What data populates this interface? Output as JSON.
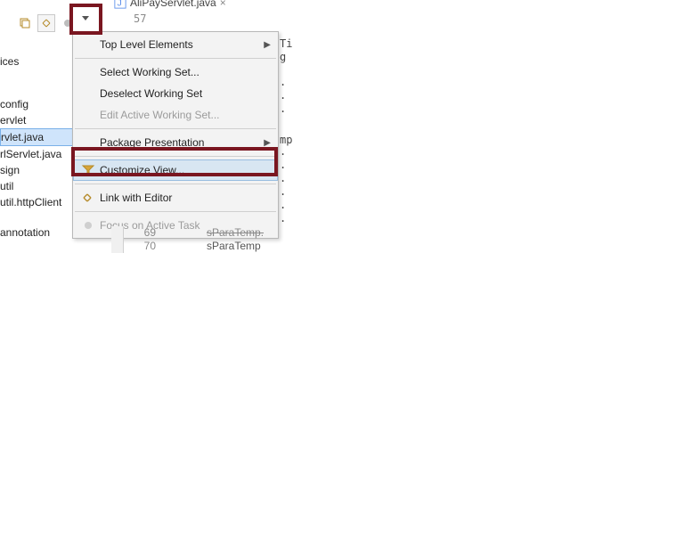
{
  "editorTab": {
    "filename": "AliPayServlet.java"
  },
  "lineVisible": "57",
  "sidebar": {
    "groupTop": "ices",
    "items": [
      "config",
      "ervlet",
      "rvlet.java",
      "rlServlet.java",
      "sign",
      "util",
      "util.httpClient"
    ],
    "groupBottom": "annotation"
  },
  "menu": {
    "topLevelElements": "Top Level Elements",
    "selectWS": "Select Working Set...",
    "deselectWS": "Deselect Working Set",
    "editWS": "Edit Active Working Set...",
    "packagePresentation": "Package Presentation",
    "customizeView": "Customize View...",
    "linkEditor": "Link with Editor",
    "focusTask": "Focus on Active Task"
  },
  "peek": {
    "l1": "Ti",
    "l2": "g",
    "l3": ".",
    "l4": ".",
    "l5": ".",
    "l6": "mp",
    "l7": ".",
    "l8": ".",
    "l9": ".",
    "l10": ".",
    "l11": ".",
    "l12": "."
  },
  "gutter": {
    "a": "69",
    "b": "70"
  },
  "codeFrag": {
    "a": "sParaTemp.",
    "b": "sParaTemp"
  }
}
